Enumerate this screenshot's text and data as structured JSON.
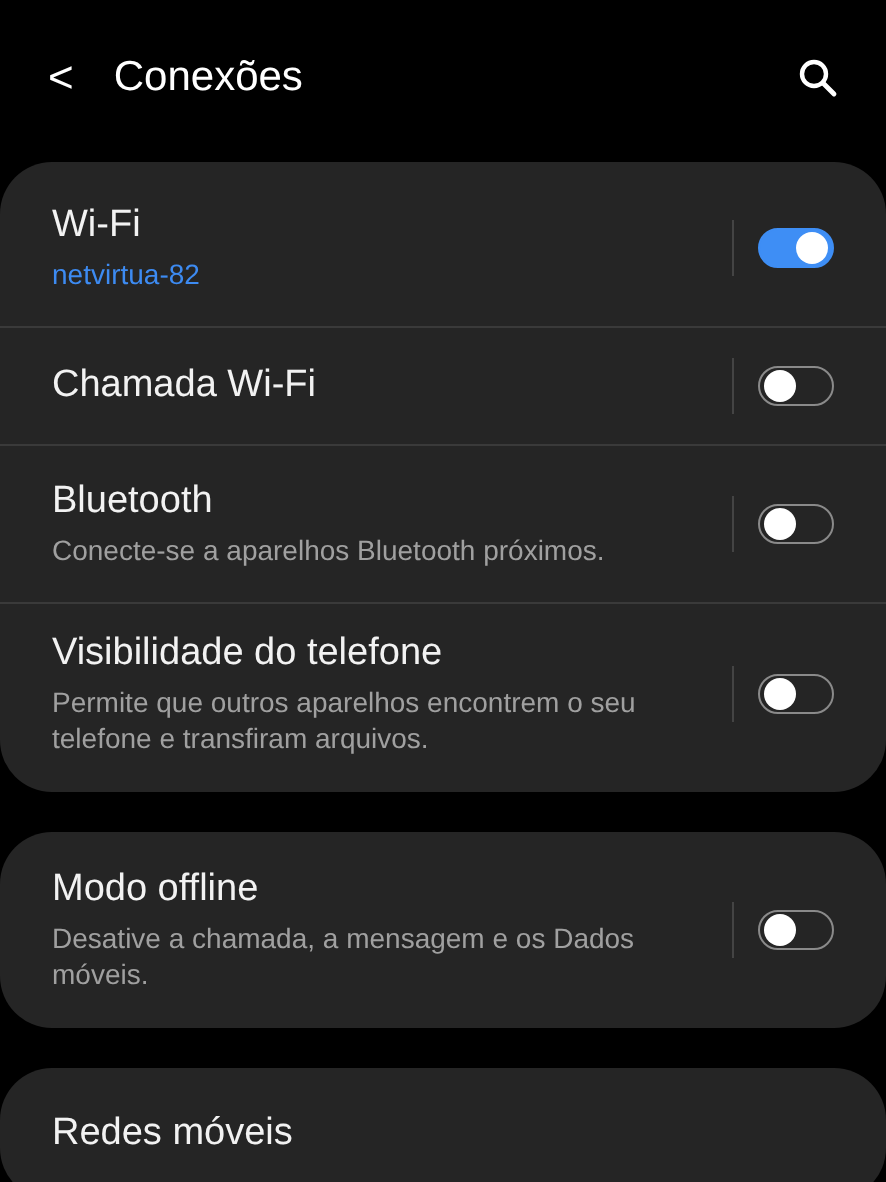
{
  "header": {
    "back": "<",
    "title": "Conexões"
  },
  "groups": [
    {
      "items": [
        {
          "kind": "status",
          "title": "Wi-Fi",
          "subtitle": "netvirtua-82",
          "on": true
        },
        {
          "title": "Chamada Wi-Fi",
          "on": false
        },
        {
          "kind": "hint",
          "title": "Bluetooth",
          "subtitle": "Conecte-se a aparelhos Bluetooth próximos.",
          "on": false
        },
        {
          "kind": "hint",
          "title": "Visibilidade do telefone",
          "subtitle": "Permite que outros aparelhos encontrem o seu telefone e transfiram arquivos.",
          "on": false
        }
      ]
    },
    {
      "items": [
        {
          "kind": "hint",
          "title": "Modo offline",
          "subtitle": "Desative a chamada, a mensagem e os Dados móveis.",
          "on": false
        }
      ]
    },
    {
      "items": [
        {
          "title": "Redes móveis"
        }
      ]
    }
  ]
}
